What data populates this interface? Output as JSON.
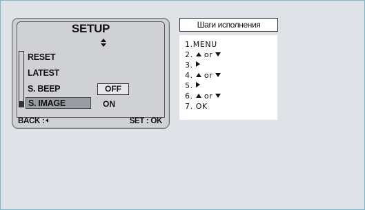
{
  "lcd": {
    "title": "SETUP",
    "menu": {
      "reset": "RESET",
      "latest": "LATEST",
      "s_beep": "S. BEEP",
      "s_image": "S. IMAGE"
    },
    "options": {
      "off": "OFF",
      "on": "ON"
    },
    "footer": {
      "back": "BACK :",
      "set": "SET : OK"
    },
    "icons": {
      "updown": "up-down-arrows-icon",
      "back": "left-arrow-icon"
    }
  },
  "steps": {
    "title": "Шаги исполнения",
    "items": {
      "s1": "1.MENU",
      "s2_prefix": "2.",
      "s2_or": "or",
      "s3_prefix": "3.",
      "s4_prefix": "4.",
      "s4_or": "or",
      "s5_prefix": "5.",
      "s6_prefix": "6.",
      "s6_or": "or",
      "s7": "7. OK"
    },
    "icons": [
      "up-triangle-icon",
      "down-triangle-icon",
      "right-triangle-icon"
    ]
  }
}
